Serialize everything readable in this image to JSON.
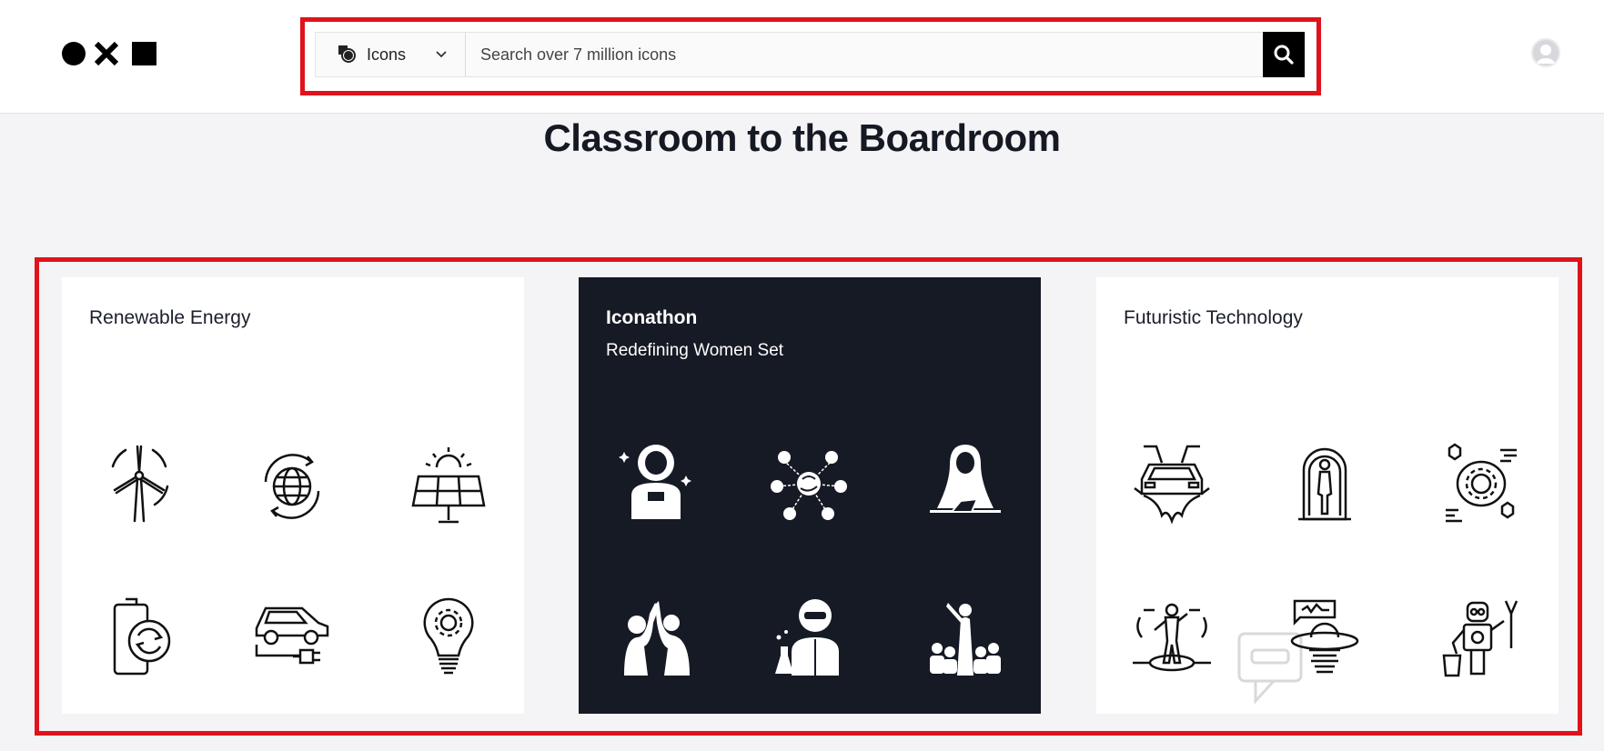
{
  "header": {
    "logo_icon": "circle-x-square-logo",
    "search": {
      "type_label": "Icons",
      "placeholder": "Search over 7 million icons",
      "value": ""
    },
    "avatar": "user-avatar"
  },
  "page": {
    "title": "Classroom to the Boardroom"
  },
  "cards": [
    {
      "title": "Renewable Energy",
      "theme": "light",
      "icons": [
        "wind-turbine-icon",
        "globe-recycle-icon",
        "solar-panel-icon",
        "battery-recycle-icon",
        "electric-car-icon",
        "lightbulb-gear-icon"
      ]
    },
    {
      "title": "Iconathon",
      "subtitle": "Redefining Women Set",
      "theme": "dark",
      "icons": [
        "woman-astronaut-icon",
        "women-network-icon",
        "woman-hijab-icon",
        "women-high-five-icon",
        "woman-scientist-icon",
        "woman-leader-icon"
      ]
    },
    {
      "title": "Futuristic Technology",
      "theme": "light",
      "icons": [
        "flying-car-icon",
        "stasis-pod-icon",
        "ai-brain-gear-icon",
        "vr-person-icon",
        "ufo-icon",
        "robot-cleaner-icon"
      ]
    }
  ],
  "colors": {
    "highlight": "#e0121b",
    "dark_card": "#161a25",
    "background": "#f4f4f6"
  }
}
